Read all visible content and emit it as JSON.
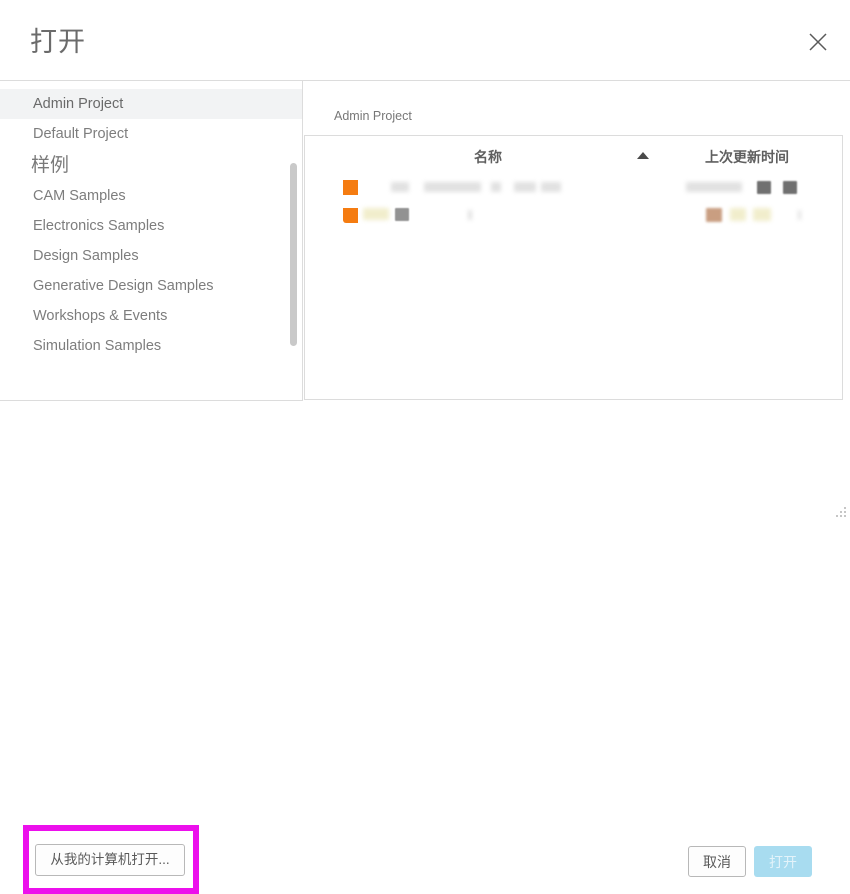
{
  "dialog": {
    "title": "打开",
    "close_icon": "close-icon"
  },
  "sidebar": {
    "scrollbar": "vertical-scrollbar",
    "items": [
      {
        "label": "Admin Project",
        "type": "item",
        "selected": true
      },
      {
        "label": "Default Project",
        "type": "item",
        "selected": false
      },
      {
        "label": "样例",
        "type": "section",
        "selected": false
      },
      {
        "label": "CAM Samples",
        "type": "item",
        "selected": false
      },
      {
        "label": "Electronics Samples",
        "type": "item",
        "selected": false
      },
      {
        "label": "Design Samples",
        "type": "item",
        "selected": false
      },
      {
        "label": "Generative Design Samples",
        "type": "item",
        "selected": false
      },
      {
        "label": "Workshops & Events",
        "type": "item",
        "selected": false
      },
      {
        "label": "Simulation Samples",
        "type": "item",
        "selected": false
      }
    ]
  },
  "main": {
    "breadcrumb": "Admin Project",
    "table": {
      "columns": {
        "name": "名称",
        "sort_indicator": "sort-ascending-icon",
        "last_updated": "上次更新时间"
      },
      "rows": [
        {
          "icon": "folder-icon",
          "name": "",
          "last_updated": ""
        },
        {
          "icon": "folder-icon",
          "name": "",
          "last_updated": ""
        }
      ]
    }
  },
  "footer": {
    "open_from_computer": "从我的计算机打开...",
    "cancel": "取消",
    "open": "打开"
  },
  "annotation": {
    "highlight_color": "#ec10ec",
    "highlight_target": "open-from-computer-button"
  },
  "colors": {
    "folder_orange": "#f57c11",
    "open_button_disabled": "#a8dcf0",
    "selected_row": "#f2f3f4",
    "border": "#dcdcdc"
  }
}
